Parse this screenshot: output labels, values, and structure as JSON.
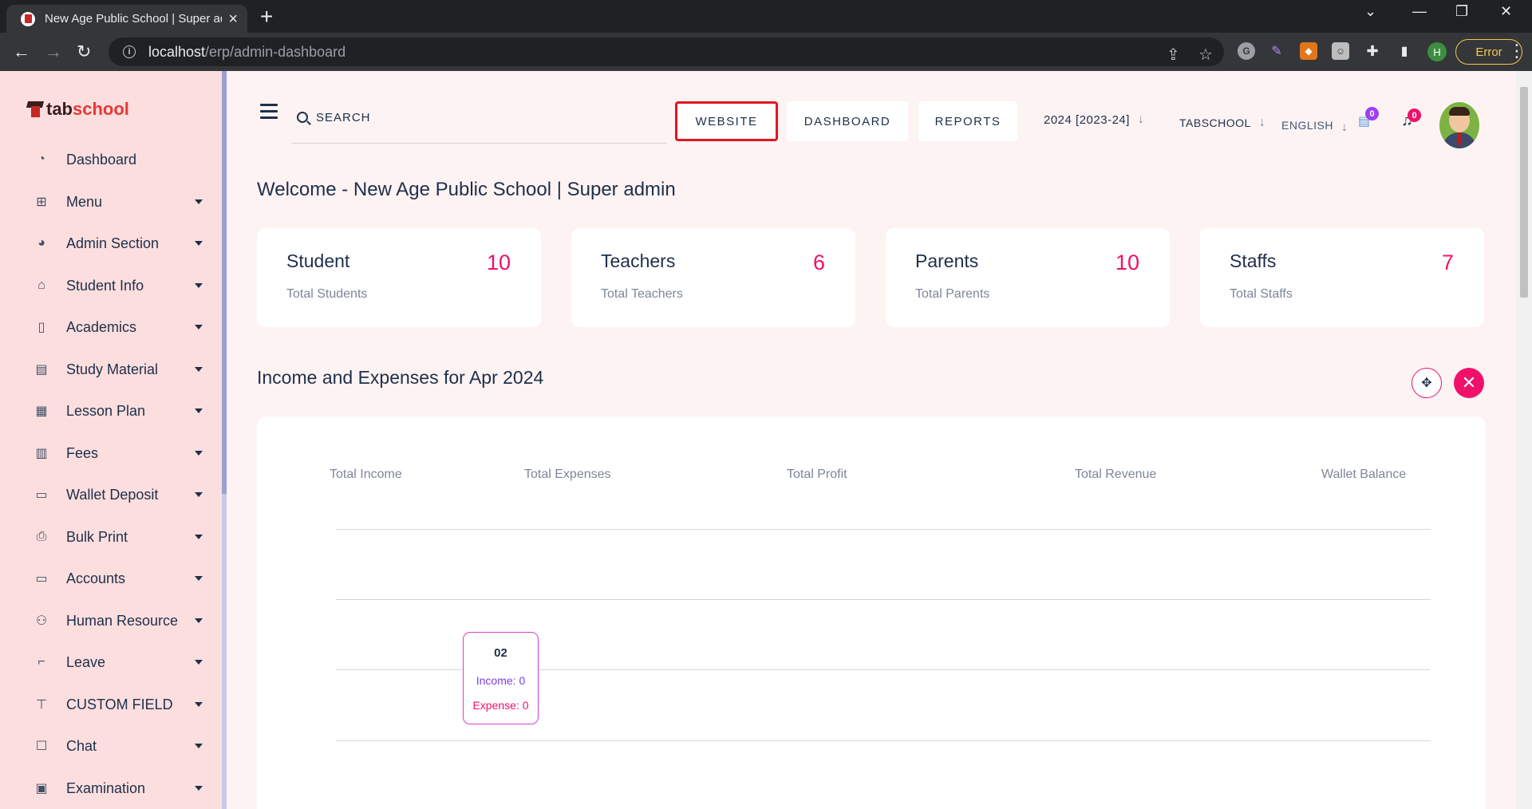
{
  "browser": {
    "tab_title": "New Age Public School | Super admin",
    "url_host": "localhost",
    "url_path": "/erp/admin-dashboard",
    "profile_initial": "H",
    "error_label": "Error"
  },
  "sidebar": {
    "logo_part1": "tab",
    "logo_part2": "school",
    "items": [
      {
        "label": "Dashboard",
        "icon": "dashboard-icon"
      },
      {
        "label": "Menu",
        "icon": "grid-icon"
      },
      {
        "label": "Admin Section",
        "icon": "pie-chart-icon"
      },
      {
        "label": "Student Info",
        "icon": "graduation-icon"
      },
      {
        "label": "Academics",
        "icon": "book-icon"
      },
      {
        "label": "Study Material",
        "icon": "document-icon"
      },
      {
        "label": "Lesson Plan",
        "icon": "calendar-edit-icon"
      },
      {
        "label": "Fees",
        "icon": "invoice-icon"
      },
      {
        "label": "Wallet Deposit",
        "icon": "wallet-icon"
      },
      {
        "label": "Bulk Print",
        "icon": "printer-icon"
      },
      {
        "label": "Accounts",
        "icon": "wallet-icon"
      },
      {
        "label": "Human Resource",
        "icon": "people-icon"
      },
      {
        "label": "Leave",
        "icon": "bed-icon"
      },
      {
        "label": "CUSTOM FIELD",
        "icon": "text-field-icon"
      },
      {
        "label": "Chat",
        "icon": "chat-icon"
      },
      {
        "label": "Examination",
        "icon": "exam-icon"
      }
    ]
  },
  "header": {
    "search_placeholder": "SEARCH",
    "website": "WEBSITE",
    "dashboard": "DASHBOARD",
    "reports": "REPORTS",
    "session": "2024 [2023-24]",
    "school": "TABSCHOOL",
    "language": "ENGLISH",
    "message_count": "0",
    "notification_count": "0"
  },
  "welcome": "Welcome - New Age Public School | Super admin",
  "stats": [
    {
      "title": "Student",
      "subtitle": "Total Students",
      "value": "10"
    },
    {
      "title": "Teachers",
      "subtitle": "Total Teachers",
      "value": "6"
    },
    {
      "title": "Parents",
      "subtitle": "Total Parents",
      "value": "10"
    },
    {
      "title": "Staffs",
      "subtitle": "Total Staffs",
      "value": "7"
    }
  ],
  "income_section": {
    "title": "Income and Expenses for Apr 2024",
    "legend": [
      "Total Income",
      "Total Expenses",
      "Total Profit",
      "Total Revenue",
      "Wallet Balance"
    ],
    "tooltip": {
      "day": "02",
      "income": "Income: 0",
      "expense": "Expense: 0"
    }
  },
  "colors": {
    "accent": "#f0106a",
    "highlight": "#e0161f",
    "text": "#1e2f4a",
    "sidebar_bg": "#fcdede"
  }
}
